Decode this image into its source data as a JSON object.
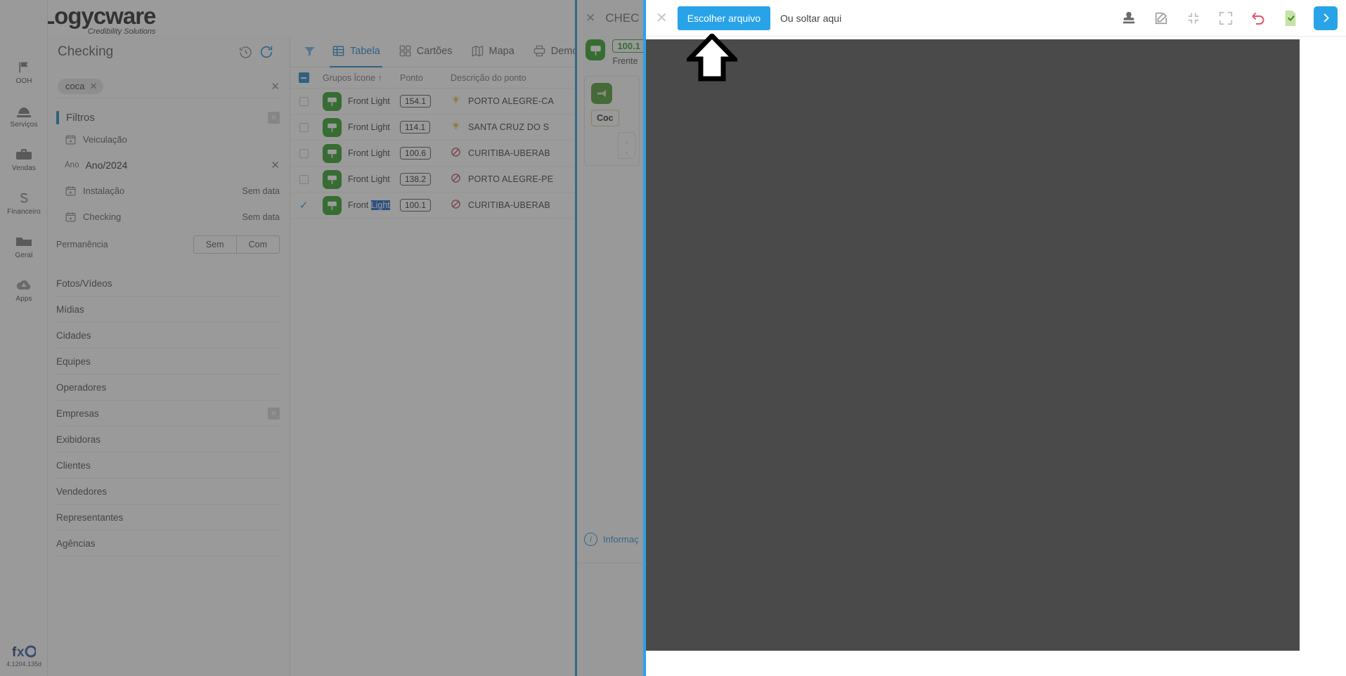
{
  "brand": {
    "name": "Logycware",
    "tagline": "Credibility Solutions"
  },
  "rail": {
    "items": [
      {
        "label": "OOH",
        "icon": "flag-icon"
      },
      {
        "label": "Serviços",
        "icon": "services-icon"
      },
      {
        "label": "Vendas",
        "icon": "briefcase-icon"
      },
      {
        "label": "Financeiro",
        "icon": "currency-s-icon"
      },
      {
        "label": "Geral",
        "icon": "folder-icon"
      },
      {
        "label": "Apps",
        "icon": "cloud-icon"
      }
    ],
    "version": "4.1204.135d"
  },
  "checking": {
    "title": "Checking",
    "history_icon": "history-icon",
    "refresh_icon": "refresh-icon"
  },
  "search": {
    "chip": "coca",
    "chip_remove": "✕",
    "clear": "✕"
  },
  "filters": {
    "title": "Filtros",
    "close": "✕",
    "veiculacao": {
      "label": "Veiculação",
      "icon": "calendar-plus-icon"
    },
    "ano": {
      "key": "Ano",
      "value": "Ano/2024",
      "clear": "✕"
    },
    "instalacao": {
      "label": "Instalação",
      "value": "Sem data",
      "icon": "calendar-plus-icon"
    },
    "checking": {
      "label": "Checking",
      "value": "Sem data",
      "icon": "calendar-plus-icon"
    },
    "permanencia": {
      "label": "Permanência",
      "option_off": "Sem",
      "option_on": "Com"
    },
    "categories": [
      {
        "label": "Fotos/Vídeos",
        "has_clear": false
      },
      {
        "label": "Mídias",
        "has_clear": false
      },
      {
        "label": "Cidades",
        "has_clear": false
      },
      {
        "label": "Equipes",
        "has_clear": false
      },
      {
        "label": "Operadores",
        "has_clear": false
      },
      {
        "label": "Empresas",
        "has_clear": true,
        "clear": "✕"
      },
      {
        "label": "Exibidoras",
        "has_clear": false
      },
      {
        "label": "Clientes",
        "has_clear": false
      },
      {
        "label": "Vendedores",
        "has_clear": false
      },
      {
        "label": "Representantes",
        "has_clear": false
      },
      {
        "label": "Agências",
        "has_clear": false
      }
    ]
  },
  "table": {
    "funnel_icon": "filter-funnel-icon",
    "tabs": [
      {
        "label": "Tabela",
        "icon": "table-icon",
        "active": true
      },
      {
        "label": "Cartões",
        "icon": "cards-icon",
        "active": false
      },
      {
        "label": "Mapa",
        "icon": "map-icon",
        "active": false
      },
      {
        "label": "Demons",
        "icon": "printer-icon",
        "active": false
      }
    ],
    "columns": [
      {
        "key": "grupos",
        "label": "Grupos Ícone",
        "sort": "↑"
      },
      {
        "key": "ponto",
        "label": "Ponto"
      },
      {
        "key": "desc",
        "label": "Descrição do ponto"
      }
    ],
    "rows": [
      {
        "selected": false,
        "group": "Front Light",
        "group_highlight": "",
        "ponto": "154.1",
        "status": "bulb",
        "desc": "PORTO ALEGRE-CA"
      },
      {
        "selected": false,
        "group": "Front Light",
        "group_highlight": "",
        "ponto": "114.1",
        "status": "bulb",
        "desc": "SANTA CRUZ DO S"
      },
      {
        "selected": false,
        "group": "Front Light",
        "group_highlight": "",
        "ponto": "100.6",
        "status": "blocked",
        "desc": "CURITIBA-UBERAB"
      },
      {
        "selected": false,
        "group": "Front Light",
        "group_highlight": "",
        "ponto": "138.2",
        "status": "blocked",
        "desc": "PORTO ALEGRE-PE"
      },
      {
        "selected": true,
        "group": "Front ",
        "group_highlight": "Light",
        "ponto": "100.1",
        "status": "blocked",
        "desc": "CURITIBA-UBERAB"
      }
    ]
  },
  "detail": {
    "close": "✕",
    "title": "CHEC",
    "pill": "100.1",
    "subtitle": "Frente",
    "card_chip": "Coc",
    "info_label": "Informaç"
  },
  "overlay": {
    "close": "✕",
    "choose_file": "Escolher arquivo",
    "drop_hint": "Ou soltar aqui",
    "tools": [
      {
        "name": "stamp-icon"
      },
      {
        "name": "edit-icon"
      },
      {
        "name": "collapse-icon"
      },
      {
        "name": "expand-icon"
      },
      {
        "name": "undo-icon"
      },
      {
        "name": "document-check-icon"
      },
      {
        "name": "next-arrow-icon"
      }
    ]
  },
  "annotation": {
    "arrow": "up-arrow-annotation"
  },
  "colors": {
    "accent_blue": "#29a3e8",
    "link_blue": "#1f86c9",
    "green": "#2ea024",
    "undo_red": "#e4556a",
    "doc_green": "#c6e2a8",
    "canvas_dark": "#4a4a4a",
    "highlight_blue": "#1a64c8"
  }
}
